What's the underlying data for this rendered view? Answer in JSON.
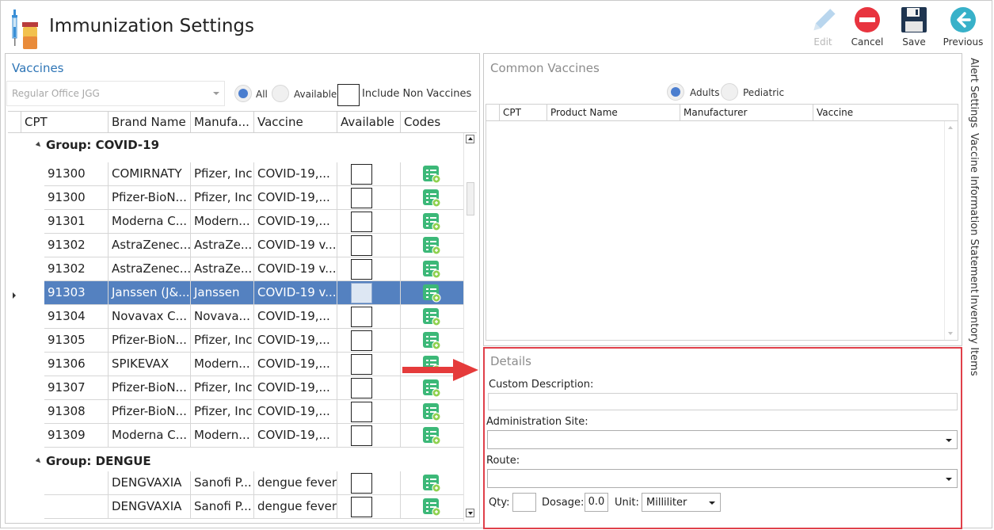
{
  "window": {
    "title": "Immunization Settings"
  },
  "toolbar": {
    "edit": "Edit",
    "cancel": "Cancel",
    "save": "Save",
    "previous": "Previous"
  },
  "vaccines": {
    "title": "Vaccines",
    "office_value": "Regular Office JGG",
    "filter_all": "All",
    "filter_available": "Available",
    "include_non_vaccines": "Include Non Vaccines",
    "selected_filter": "All",
    "columns": [
      "CPT",
      "Brand Name",
      "Manufa...",
      "Vaccine",
      "Available",
      "Codes"
    ],
    "groups": [
      {
        "label": "Group: COVID-19",
        "rows": [
          {
            "cpt": "91300",
            "brand": "COMIRNATY",
            "manufacturer": "Pfizer, Inc",
            "vaccine": "COVID-19,...",
            "available": false
          },
          {
            "cpt": "91300",
            "brand": "Pfizer-BioN...",
            "manufacturer": "Pfizer, Inc",
            "vaccine": "COVID-19,...",
            "available": false
          },
          {
            "cpt": "91301",
            "brand": "Moderna C...",
            "manufacturer": "Modern...",
            "vaccine": "COVID-19,...",
            "available": false
          },
          {
            "cpt": "91302",
            "brand": "AstraZenec...",
            "manufacturer": "AstraZe...",
            "vaccine": "COVID-19 v...",
            "available": false
          },
          {
            "cpt": "91302",
            "brand": "AstraZenec...",
            "manufacturer": "AstraZe...",
            "vaccine": "COVID-19 v...",
            "available": false
          },
          {
            "cpt": "91303",
            "brand": "Janssen (J&...",
            "manufacturer": "Janssen",
            "vaccine": "COVID-19 v...",
            "available": false,
            "selected": true
          },
          {
            "cpt": "91304",
            "brand": "Novavax C...",
            "manufacturer": "Novava...",
            "vaccine": "COVID-19,...",
            "available": false
          },
          {
            "cpt": "91305",
            "brand": "Pfizer-BioN...",
            "manufacturer": "Pfizer, Inc",
            "vaccine": "COVID-19,...",
            "available": false
          },
          {
            "cpt": "91306",
            "brand": "SPIKEVAX",
            "manufacturer": "Modern...",
            "vaccine": "COVID-19,...",
            "available": false
          },
          {
            "cpt": "91307",
            "brand": "Pfizer-BioN...",
            "manufacturer": "Pfizer, Inc",
            "vaccine": "COVID-19,...",
            "available": false
          },
          {
            "cpt": "91308",
            "brand": "Pfizer-BioN...",
            "manufacturer": "Pfizer, Inc",
            "vaccine": "COVID-19,...",
            "available": false
          },
          {
            "cpt": "91309",
            "brand": "Moderna C...",
            "manufacturer": "Modern...",
            "vaccine": "COVID-19,...",
            "available": false
          }
        ]
      },
      {
        "label": "Group: DENGUE",
        "rows": [
          {
            "cpt": "",
            "brand": "DENGVAXIA",
            "manufacturer": "Sanofi P...",
            "vaccine": "dengue fever",
            "available": false
          },
          {
            "cpt": "",
            "brand": "DENGVAXIA",
            "manufacturer": "Sanofi P...",
            "vaccine": "dengue fever",
            "available": false
          }
        ]
      }
    ]
  },
  "common_vaccines": {
    "title": "Common Vaccines",
    "option_adults": "Adults",
    "option_pediatric": "Pediatric",
    "selected": "Adults",
    "columns": [
      "CPT",
      "Product Name",
      "Manufacturer",
      "Vaccine"
    ]
  },
  "details": {
    "title": "Details",
    "custom_description_label": "Custom Description:",
    "custom_description_value": "",
    "administration_site_label": "Administration Site:",
    "administration_site_value": "",
    "route_label": "Route:",
    "route_value": "",
    "qty_label": "Qty:",
    "qty_value": "",
    "dosage_label": "Dosage:",
    "dosage_value": "0.0",
    "unit_label": "Unit:",
    "unit_value": "Milliliter"
  },
  "side_tabs": [
    "Alert Settings",
    "Vaccine Information Statement",
    "Inventory Items"
  ],
  "colors": {
    "accent": "#2e75b6",
    "selected_row": "#5481c0",
    "highlight_border": "#e0404a",
    "cancel_red": "#e8343f",
    "previous_teal": "#38b1c9",
    "codes_green": "#3cb878"
  }
}
